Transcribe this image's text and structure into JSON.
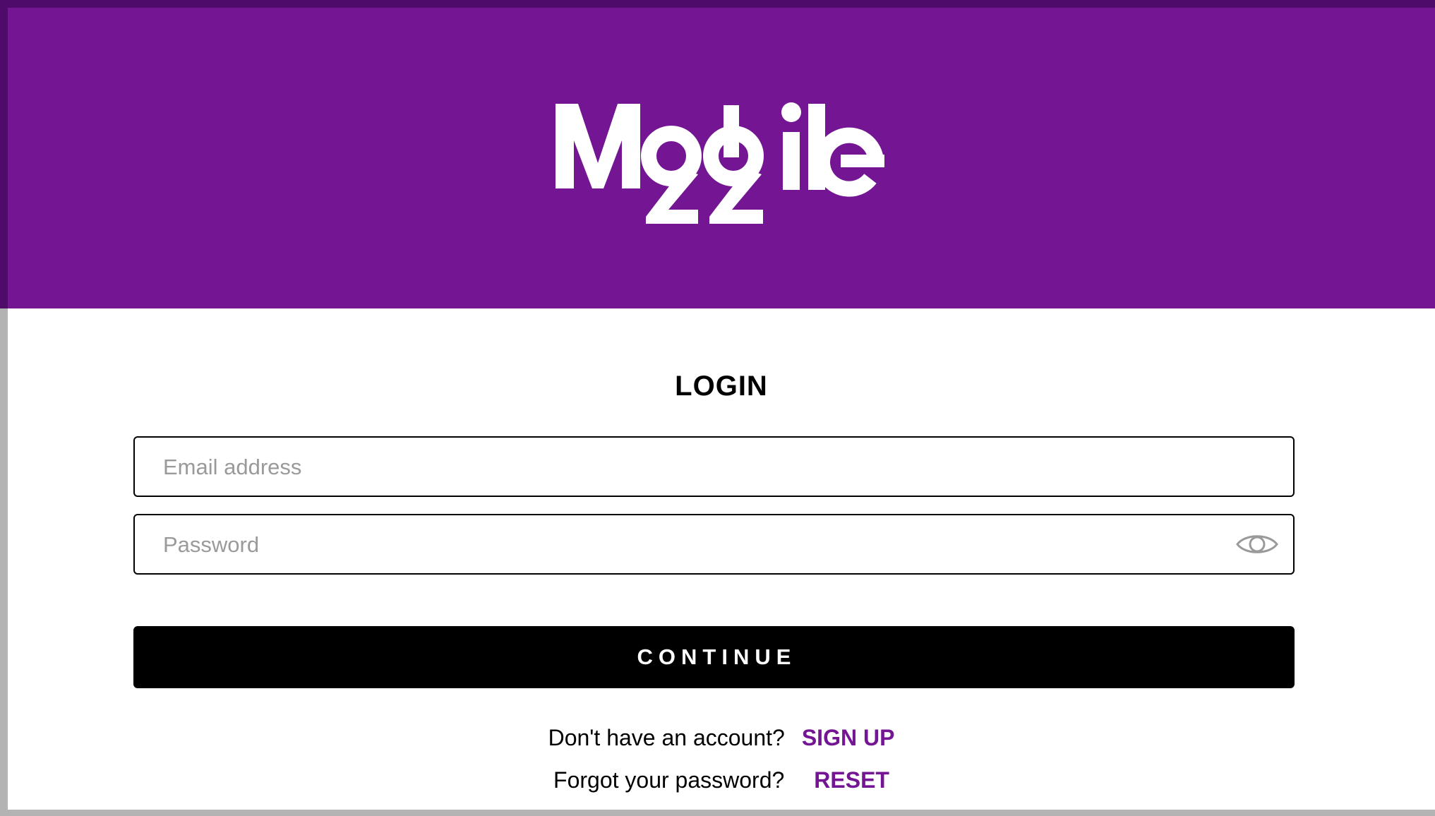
{
  "header": {
    "background_color": "#741593",
    "logo_text": "Mobile 22"
  },
  "login": {
    "title": "LOGIN",
    "email": {
      "placeholder": "Email address",
      "value": ""
    },
    "password": {
      "placeholder": "Password",
      "value": "",
      "toggle_icon": "eye-icon"
    },
    "continue_label": "CONTINUE",
    "signup_prompt": "Don't have an account?",
    "signup_link": "SIGN UP",
    "reset_prompt": "Forgot your password?",
    "reset_link": "RESET"
  },
  "colors": {
    "brand_purple": "#741593",
    "button_black": "#000000"
  }
}
